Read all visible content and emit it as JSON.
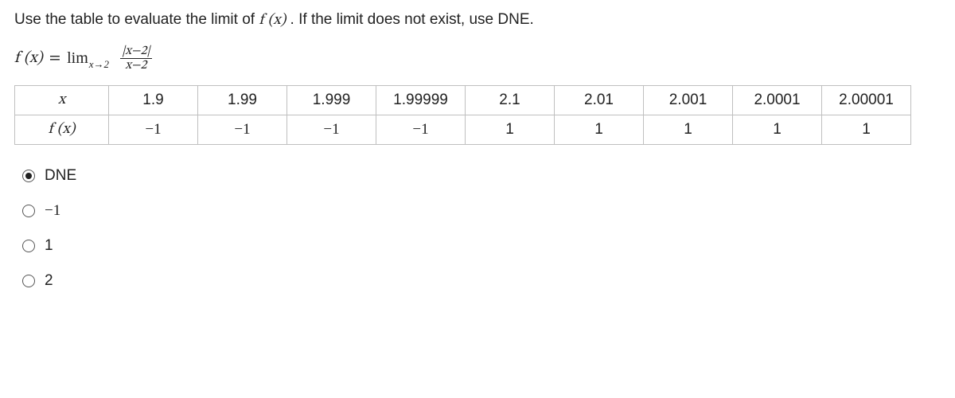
{
  "instruction": {
    "pre": "Use the table to evaluate the limit of ",
    "fx": "f (x)",
    "post": ". If the limit does not exist, use DNE."
  },
  "formula": {
    "lhs_f": "f (x)",
    "eq": "=",
    "lim": "lim",
    "lim_sub": "x→2",
    "num": "|x−2|",
    "den": "x−2"
  },
  "table": {
    "row1_label": "x",
    "row2_label": "f (x)",
    "xvals": [
      "1.9",
      "1.99",
      "1.999",
      "1.99999",
      "2.1",
      "2.01",
      "2.001",
      "2.0001",
      "2.00001"
    ],
    "fvals": [
      "−1",
      "−1",
      "−1",
      "−1",
      "1",
      "1",
      "1",
      "1",
      "1"
    ]
  },
  "options": [
    {
      "label": "DNE",
      "selected": true
    },
    {
      "label": "−1",
      "selected": false
    },
    {
      "label": "1",
      "selected": false
    },
    {
      "label": "2",
      "selected": false
    }
  ]
}
